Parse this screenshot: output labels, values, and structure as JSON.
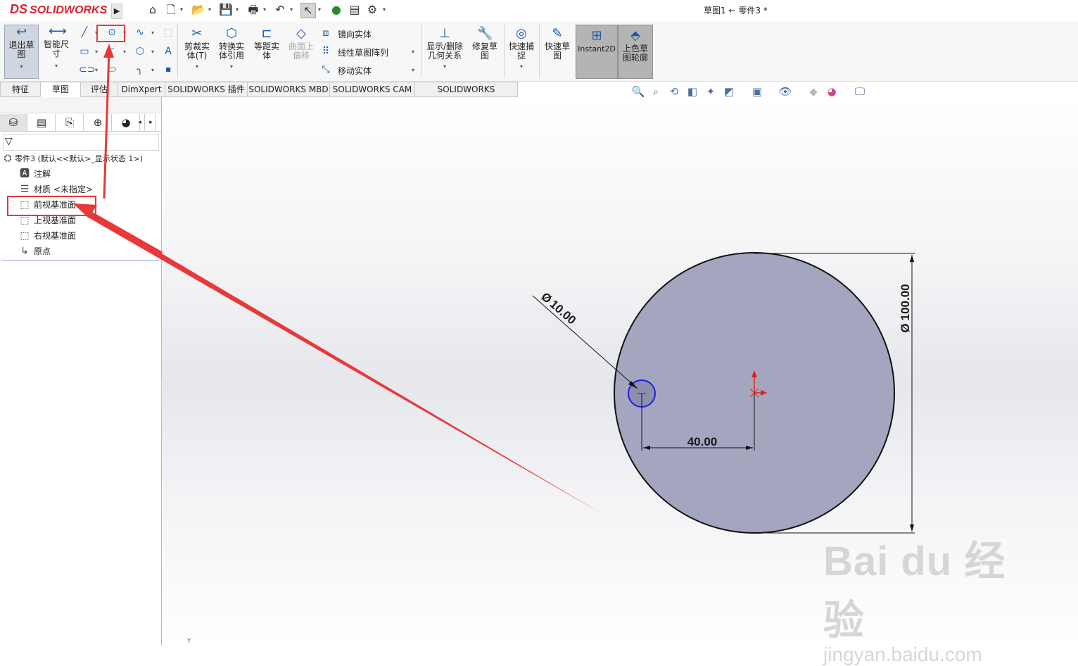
{
  "app": {
    "logo_prefix": "DS",
    "logo_text": "SOLIDWORKS",
    "document_title": "草图1 ← 零件3 *"
  },
  "quick_access": {
    "icons": [
      "home-icon",
      "new-document-icon",
      "open-icon",
      "save-icon",
      "print-icon",
      "undo-icon",
      "select-icon",
      "traffic-light-icon",
      "file-properties-icon",
      "options-gear-icon"
    ]
  },
  "command_manager": {
    "exit_sketch": "退出草图",
    "smart_dimension": "智能尺寸",
    "trim": "剪裁实体(T)",
    "convert": "转换实体引用",
    "offset": "等距实体",
    "surface_offset": "曲面上偏移",
    "mirror": "镜向实体",
    "linear_pattern": "线性草图阵列",
    "move": "移动实体",
    "display_relations": "显示/删除几何关系",
    "repair": "修复草图",
    "quick_snaps": "快速捕捉",
    "rapid_sketch": "快速草图",
    "instant2d": "Instant2D",
    "shaded_contours": "上色草图轮廓"
  },
  "tabs": [
    {
      "label": "特征",
      "active": false
    },
    {
      "label": "草图",
      "active": true
    },
    {
      "label": "评估",
      "active": false
    },
    {
      "label": "DimXpert",
      "active": false
    },
    {
      "label": "SOLIDWORKS 插件",
      "active": false
    },
    {
      "label": "SOLIDWORKS MBD",
      "active": false
    },
    {
      "label": "SOLIDWORKS CAM",
      "active": false
    },
    {
      "label": "SOLIDWORKS Inspection",
      "active": false
    }
  ],
  "feature_tree": {
    "root": "零件3  (默认<<默认>_显示状态 1>)",
    "items": [
      {
        "label": "注解",
        "icon": "annotations-icon"
      },
      {
        "label": "材质 <未指定>",
        "icon": "material-icon"
      },
      {
        "label": "前视基准面",
        "icon": "plane-icon"
      },
      {
        "label": "上视基准面",
        "icon": "plane-icon"
      },
      {
        "label": "右视基准面",
        "icon": "plane-icon"
      },
      {
        "label": "原点",
        "icon": "origin-icon"
      }
    ]
  },
  "sketch": {
    "dim_large_circle": "100.00",
    "dim_small_circle": "10.00",
    "dim_offset": "40.00",
    "diameter_symbol": "Ø",
    "large_circle_fill": "#a4a6c0",
    "small_circle_stroke": "#1a22d6",
    "origin_color": "#e0201c"
  },
  "annotation": {
    "color": "#e8383a"
  },
  "watermark": {
    "main": "Bai du 经验",
    "sub": "jingyan.baidu.com"
  },
  "status": {
    "axis_label": "Y"
  }
}
